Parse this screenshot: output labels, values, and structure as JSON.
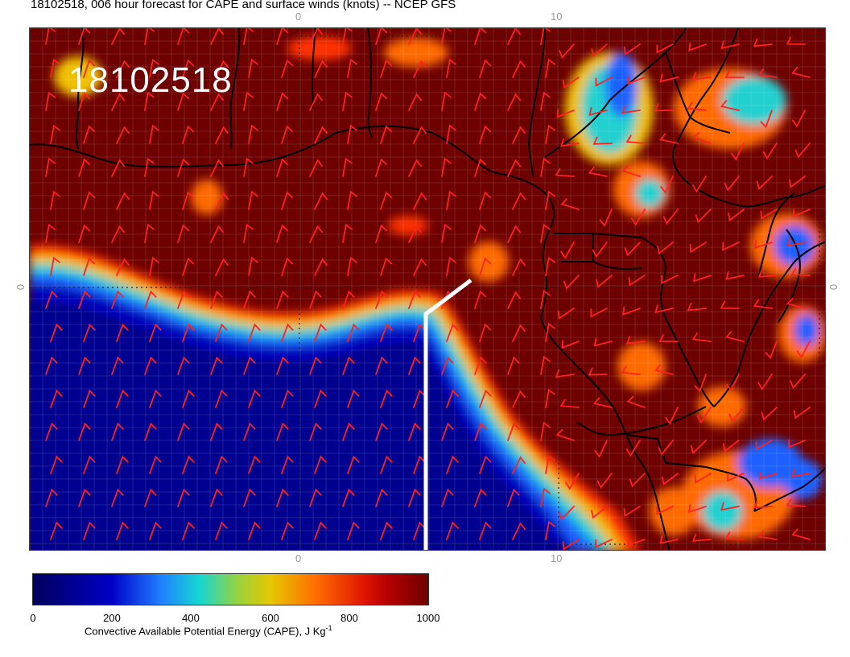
{
  "title": "18102518, 006 hour forecast for CAPE and surface winds (knots) -- NCEP GFS",
  "stamp": "18102518",
  "axes": {
    "top": [
      "0",
      "10"
    ],
    "bottom": [
      "0",
      "10"
    ],
    "left": "0",
    "right": "0"
  },
  "colorbar": {
    "ticks": [
      "0",
      "200",
      "400",
      "600",
      "800",
      "1000"
    ],
    "label_main": "Convective Available Potential Energy (CAPE), J Kg",
    "label_exp": "-1",
    "colors": [
      "#00005c",
      "#0000c8",
      "#1f7dff",
      "#14d7d2",
      "#9ad23c",
      "#e6c800",
      "#ff6a00",
      "#e01400",
      "#b40000",
      "#6e0000"
    ]
  },
  "colors": {
    "high_cape": "#6e0000",
    "low_cape": "#0000a0",
    "wind_barb": "#ff2020",
    "coastline": "#000000",
    "marker_line": "#ffffff"
  }
}
